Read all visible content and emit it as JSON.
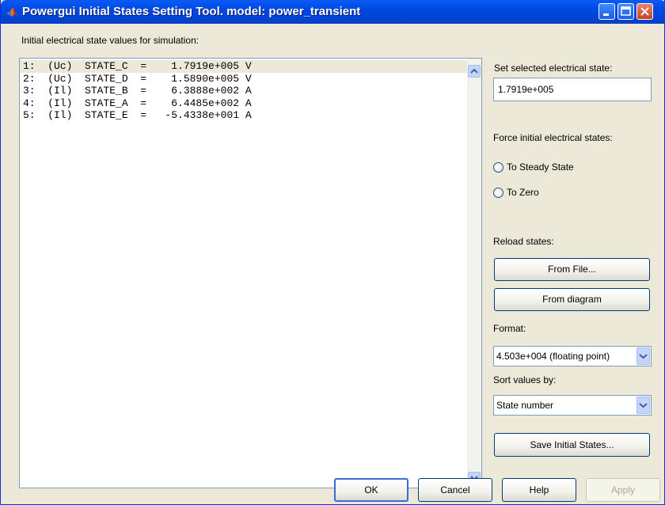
{
  "window": {
    "title": "Powergui Initial States Setting Tool.  model: power_transient"
  },
  "list_label": "Initial electrical state values for simulation:",
  "states": [
    {
      "text": "1:  (Uc)  STATE_C  =    1.7919e+005 V"
    },
    {
      "text": "2:  (Uc)  STATE_D  =    1.5890e+005 V"
    },
    {
      "text": "3:  (Il)  STATE_B  =    6.3888e+002 A"
    },
    {
      "text": "4:  (Il)  STATE_A  =    6.4485e+002 A"
    },
    {
      "text": "5:  (Il)  STATE_E  =   -5.4338e+001 A"
    }
  ],
  "selected_state_index": 0,
  "right_panel": {
    "set_selected_label": "Set selected electrical state:",
    "set_selected_value": "1.7919e+005",
    "force_label": "Force initial electrical states:",
    "radio_steady": "To Steady State",
    "radio_zero": "To Zero",
    "reload_label": "Reload states:",
    "from_file_button": "From File...",
    "from_diagram_button": "From diagram",
    "format_label": "Format:",
    "format_value": "4.503e+004 (floating point)",
    "sort_label": "Sort values by:",
    "sort_value": "State number",
    "save_button": "Save Initial States..."
  },
  "footer": {
    "ok": "OK",
    "cancel": "Cancel",
    "help": "Help",
    "apply": "Apply"
  },
  "icons": [
    "matlab-logo-icon",
    "minimize-icon",
    "maximize-icon",
    "close-icon",
    "scroll-up-icon",
    "scroll-down-icon",
    "dropdown-arrow-icon"
  ]
}
